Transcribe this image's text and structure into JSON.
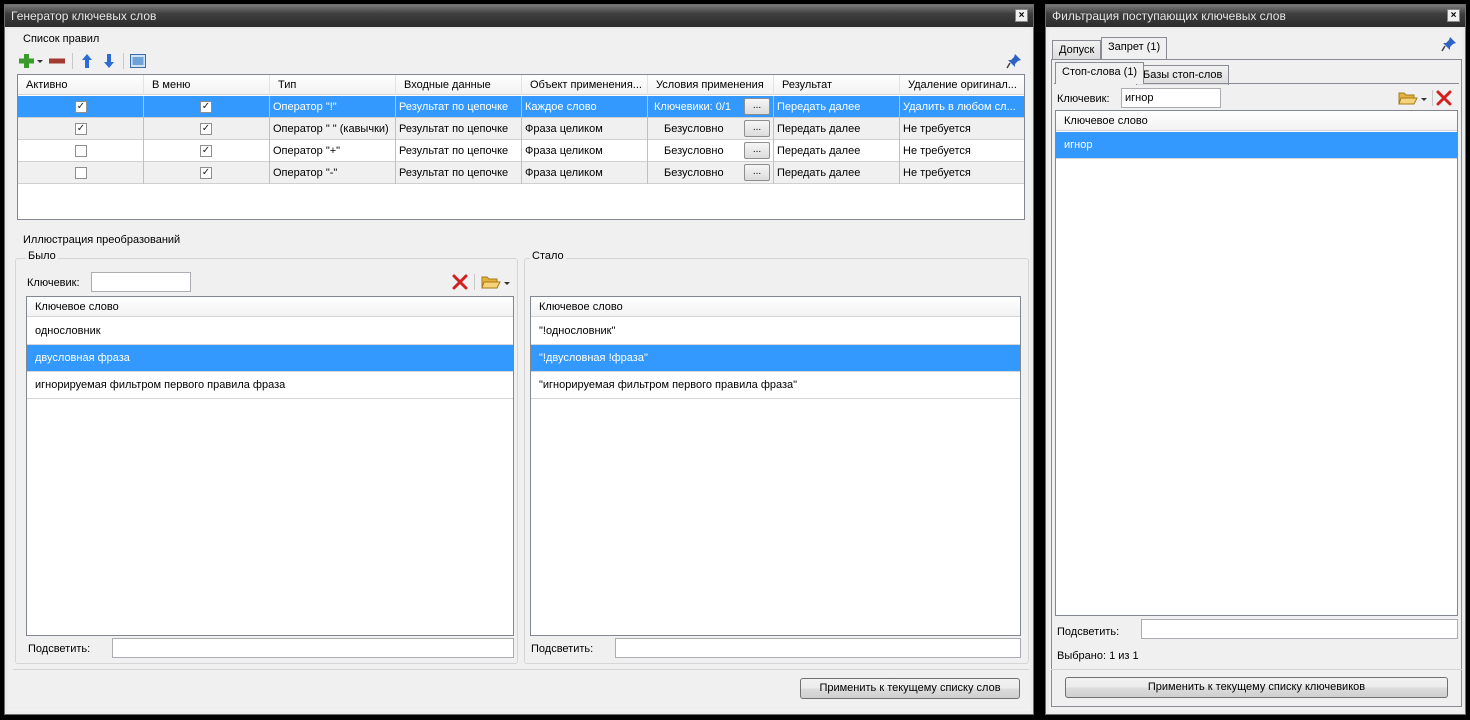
{
  "gen": {
    "title": "Генератор ключевых слов",
    "close": "×",
    "rules_group": "Список правил",
    "columns": [
      "Активно",
      "В меню",
      "Тип",
      "Входные данные",
      "Объект применения...",
      "Условия применения",
      "Результат",
      "Удаление оригинал..."
    ],
    "rows": [
      {
        "active": true,
        "menu": true,
        "type": "Оператор \"!\"",
        "input": "Результат по цепочке",
        "object": "Каждое слово",
        "cond": "Ключевики: 0/1",
        "result": "Передать далее",
        "delete": "Удалить в любом сл...",
        "selected": true
      },
      {
        "active": true,
        "menu": true,
        "type": "Оператор \" \" (кавычки)",
        "input": "Результат по цепочке",
        "object": "Фраза целиком",
        "cond": "Безусловно",
        "result": "Передать далее",
        "delete": "Не требуется",
        "selected": false
      },
      {
        "active": false,
        "menu": true,
        "type": "Оператор \"+\"",
        "input": "Результат по цепочке",
        "object": "Фраза целиком",
        "cond": "Безусловно",
        "result": "Передать далее",
        "delete": "Не требуется",
        "selected": false
      },
      {
        "active": false,
        "menu": true,
        "type": "Оператор \"-\"",
        "input": "Результат по цепочке",
        "object": "Фраза целиком",
        "cond": "Безусловно",
        "result": "Передать далее",
        "delete": "Не требуется",
        "selected": false
      }
    ],
    "ellipsis": "...",
    "illustration_group": "Иллюстрация преобразований",
    "before": {
      "title": "Было",
      "kw_label": "Ключевик:",
      "kw_value": "",
      "header": "Ключевое слово",
      "items": [
        "однословник",
        "двусловная фраза",
        "игнорируемая фильтром первого правила фраза"
      ],
      "selected_index": 1,
      "highlight_label": "Подсветить:",
      "highlight_value": ""
    },
    "after": {
      "title": "Стало",
      "header": "Ключевое слово",
      "items": [
        "\"!однословник\"",
        "\"!двусловная !фраза\"",
        "\"игнорируемая фильтром первого правила фраза\""
      ],
      "selected_index": 1,
      "highlight_label": "Подсветить:",
      "highlight_value": ""
    },
    "apply_button": "Применить к текущему списку слов"
  },
  "filter": {
    "title": "Фильтрация поступающих ключевых слов",
    "close": "×",
    "tabs": [
      "Допуск",
      "Запрет (1)"
    ],
    "active_tab": 1,
    "subtabs": [
      "Стоп-слова (1)",
      "Базы стоп-слов"
    ],
    "active_subtab": 0,
    "kw_label": "Ключевик:",
    "kw_value": "игнор",
    "header": "Ключевое слово",
    "items": [
      "игнор"
    ],
    "selected_index": 0,
    "highlight_label": "Подсветить:",
    "highlight_value": "",
    "selected_text": "Выбрано: 1 из 1",
    "apply_button": "Применить к текущему списку ключевиков"
  },
  "colors": {
    "selection": "#3399ff",
    "titlebar": "#2c2c2c",
    "window_bg": "#f0f0f0"
  }
}
